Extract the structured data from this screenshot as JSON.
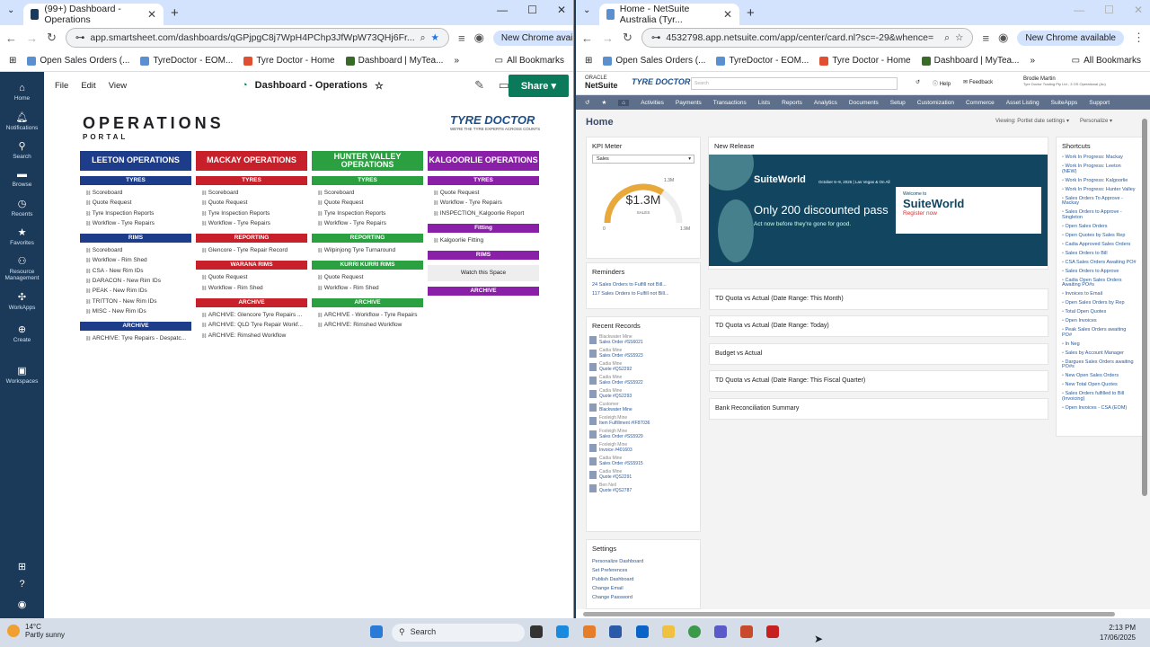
{
  "left": {
    "tab_title": "(99+) Dashboard - Operations",
    "url": "app.smartsheet.com/dashboards/qGPjpgC8j7WpH4PChp3JfWpW73QHj6Fr...",
    "new_chrome": "New Chrome available",
    "bookmarks": [
      "Open Sales Orders (...",
      "TyreDoctor - EOM...",
      "Tyre Doctor - Home",
      "Dashboard | MyTea..."
    ],
    "all_bookmarks": "All Bookmarks",
    "menu": {
      "file": "File",
      "edit": "Edit",
      "view": "View"
    },
    "dash_title": "Dashboard - Operations",
    "share": "Share",
    "nav": [
      "Home",
      "Notifications",
      "Search",
      "Browse",
      "Recents",
      "Favorites",
      "Resource Management",
      "WorkApps",
      "Create",
      "Workspaces"
    ],
    "op_title": "OPERATIONS",
    "op_sub": "PORTAL",
    "logo": "TYRE DOCTOR",
    "logo_sub": "WE'RE THE TYRE EXPERTS ACROSS COUNTS",
    "columns": [
      {
        "title": "LEETON OPERATIONS",
        "sections": [
          {
            "name": "TYRES",
            "links": [
              "Scoreboard",
              "Quote Request",
              "Tyre Inspection Reports",
              "Workflow - Tyre Repairs"
            ]
          },
          {
            "name": "RIMS",
            "links": [
              "Scoreboard",
              "Workflow - Rim Shed",
              "CSA - New Rim IDs",
              "DARACON - New Rim IDs",
              "PEAK - New Rim IDs",
              "TRITTON - New Rim IDs",
              "MISC - New Rim IDs"
            ]
          },
          {
            "name": "ARCHIVE",
            "links": [
              "ARCHIVE: Tyre Repairs - Despatc..."
            ]
          }
        ]
      },
      {
        "title": "MACKAY OPERATIONS",
        "sections": [
          {
            "name": "TYRES",
            "links": [
              "Scoreboard",
              "Quote Request",
              "Tyre Inspection Reports",
              "Workflow - Tyre Repairs"
            ]
          },
          {
            "name": "REPORTING",
            "links": [
              "Glencore - Tyre Repair Record"
            ]
          },
          {
            "name": "WARANA RIMS",
            "links": [
              "Quote Request",
              "Workflow - Rim Shed"
            ]
          },
          {
            "name": "ARCHIVE",
            "links": [
              "ARCHIVE: Glencore Tyre Repairs ...",
              "ARCHIVE: QLD Tyre Repair Workf...",
              "ARCHIVE: Rimshed Workflow"
            ]
          }
        ]
      },
      {
        "title": "HUNTER VALLEY OPERATIONS",
        "sections": [
          {
            "name": "TYRES",
            "links": [
              "Scoreboard",
              "Quote Request",
              "Tyre Inspection Reports",
              "Workflow - Tyre Repairs"
            ]
          },
          {
            "name": "REPORTING",
            "links": [
              "Wilpinjong Tyre Turnaround"
            ]
          },
          {
            "name": "KURRI KURRI RIMS",
            "links": [
              "Quote Request",
              "Workflow - Rim Shed"
            ]
          },
          {
            "name": "ARCHIVE",
            "links": [
              "ARCHIVE - Workflow - Tyre Repairs",
              "ARCHIVE: Rimshed Workflow"
            ]
          }
        ]
      },
      {
        "title": "KALGOORLIE OPERATIONS",
        "sections": [
          {
            "name": "TYRES",
            "links": [
              "Quote Request",
              "Workflow - Tyre Repairs",
              "INSPECTION_Kalgoorlie Report"
            ]
          },
          {
            "name": "Fitting",
            "links": [
              "Kalgoorlie Fitting"
            ]
          },
          {
            "name": "RIMS",
            "links": [],
            "watch": "Watch this Space"
          },
          {
            "name": "ARCHIVE",
            "links": []
          }
        ]
      }
    ]
  },
  "right": {
    "tab_title": "Home - NetSuite Australia (Tyr...",
    "url": "4532798.app.netsuite.com/app/center/card.nl?sc=-29&whence=",
    "new_chrome": "New Chrome available",
    "bookmarks": [
      "Open Sales Orders (...",
      "TyreDoctor - EOM...",
      "Tyre Doctor - Home",
      "Dashboard | MyTea..."
    ],
    "all_bookmarks": "All Bookmarks",
    "brand": "NetSuite",
    "brand_top": "ORACLE",
    "td_logo": "TYRE DOCTOR",
    "search_ph": "Search",
    "help": "Help",
    "feedback": "Feedback",
    "user": "Brodie Martin",
    "user_sub": "Tyre Doctor Trading Pty Ltd - 3 OS Operational (Au)",
    "nav": [
      "Activities",
      "Payments",
      "Transactions",
      "Lists",
      "Reports",
      "Analytics",
      "Documents",
      "Setup",
      "Customization",
      "Commerce",
      "Asset Listing",
      "SuiteApps",
      "Support"
    ],
    "home": "Home",
    "viewing": "Viewing: Portlet date settings",
    "personalize": "Personalize",
    "kpi_title": "KPI Meter",
    "kpi_select": "Sales",
    "kpi_value": "$1.3M",
    "kpi_label": "SALES",
    "kpi_min": "0",
    "kpi_max": "1.9M",
    "kpi_mark": "1.3M",
    "kpi_fraction": 0.68,
    "reminders_title": "Reminders",
    "reminders": [
      "24 Sales Orders to Fulfill not Bill...",
      "117 Sales Orders to Fulfill not Bill..."
    ],
    "recent_title": "Recent Records",
    "recent": [
      {
        "a": "Blackwater Mine",
        "b": "Sales Order #SS6021"
      },
      {
        "a": "Cadia Mine",
        "b": "Sales Order #SS5923"
      },
      {
        "a": "Cadia Mine",
        "b": "Quote #QS2292"
      },
      {
        "a": "Cadia Mine",
        "b": "Sales Order #SS5922"
      },
      {
        "a": "Cadia Mine",
        "b": "Quote #QS2293"
      },
      {
        "a": "Customer",
        "b": "Blackwater Mine"
      },
      {
        "a": "Foxleigh Mine",
        "b": "Item Fulfillment #IF87036"
      },
      {
        "a": "Foxleigh Mine",
        "b": "Sales Order #SS5929"
      },
      {
        "a": "Foxleigh Mine",
        "b": "Invoice #401603"
      },
      {
        "a": "Cadia Mine",
        "b": "Sales Order #SS5915"
      },
      {
        "a": "Cadia Mine",
        "b": "Quote #QS2291"
      },
      {
        "a": "Ben Neil",
        "b": "Quote #QS2787"
      }
    ],
    "settings_title": "Settings",
    "settings": [
      "Personalize Dashboard",
      "Set Preferences",
      "Publish Dashboard",
      "Change Email",
      "Change Password"
    ],
    "new_release": "New Release",
    "sw_title": "SuiteWorld",
    "sw_date": "October 6–9, 2025  |  Las Vegas & On All",
    "sw_main": "Only 200 discounted pass",
    "sw_sub": "Act now before they're gone for good.",
    "sw_card_a": "Welcome to",
    "sw_card_b": "SuiteWorld",
    "sw_card_c": "Register now",
    "portlets": [
      "TD Quota vs Actual (Date Range: This Month)",
      "TD Quota vs Actual (Date Range: Today)",
      "Budget vs Actual",
      "TD Quota vs Actual (Date Range: This Fiscal Quarter)",
      "Bank Reconciliation Summary"
    ],
    "shortcuts_title": "Shortcuts",
    "shortcuts": [
      "Work In Progress: Mackay",
      "Work In Progress: Leeton (NEW)",
      "Work In Progress: Kalgoorlie",
      "Work In Progress: Hunter Valley",
      "Sales Orders To Approve - Mackay",
      "Sales Orders to Approve - Singleton",
      "Open Sales Orders",
      "Open Quotes by Sales Rep",
      "Cadia Approved Sales Orders",
      "Sales Orders to Bill",
      "CSA Sales Orders Awaiting PO#",
      "Sales Orders to Approve",
      "Cadia Open Sales Orders Awaiting PO#s",
      "Invoices to Email",
      "Open Sales Orders by Rep",
      "Total Open Quotes",
      "Open Invoices",
      "Peak Sales Orders awaiting PO#",
      "In Neg",
      "Sales by Account Manager",
      "Dargues Sales Orders awaiting PO#s",
      "New Open Sales Orders",
      "New Total Open Quotes",
      "Sales Orders fulfilled to Bill (Invoicing)",
      "Open Invoices - CSA (EOM)"
    ]
  },
  "taskbar": {
    "temp": "14°C",
    "weather": "Partly sunny",
    "search": "Search",
    "time": "2:13 PM",
    "date": "17/06/2025"
  }
}
